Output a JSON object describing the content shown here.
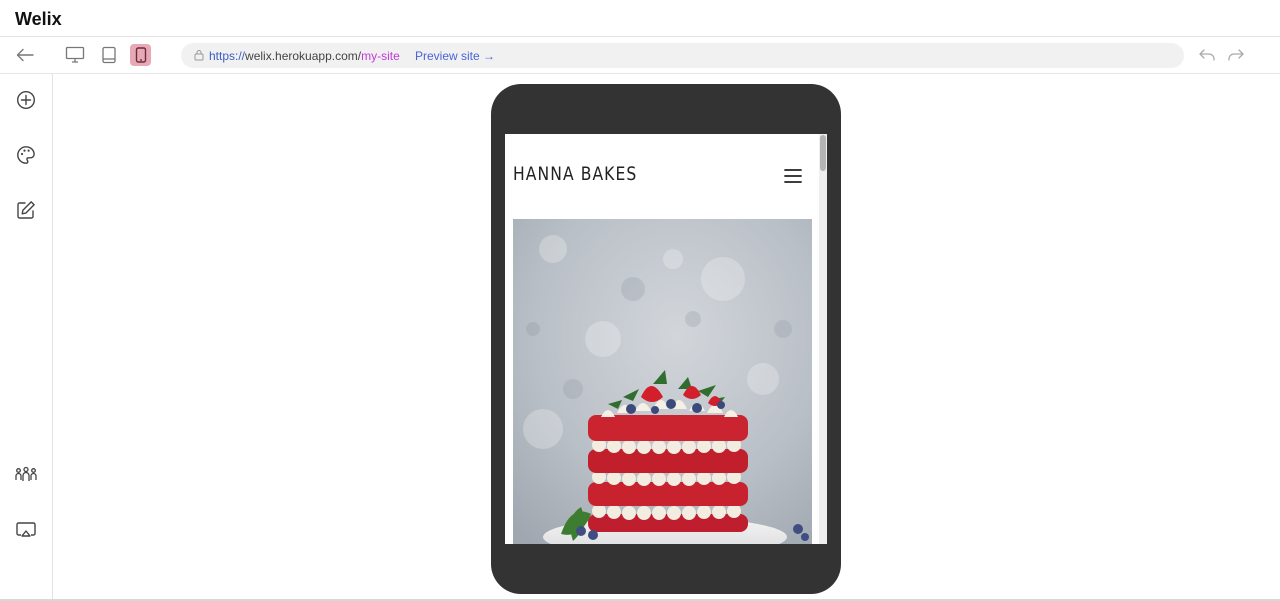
{
  "app": {
    "title": "Welix"
  },
  "toolbar": {
    "back_icon": "arrow-left-icon",
    "views": [
      {
        "name": "desktop",
        "icon": "desktop-icon",
        "active": false
      },
      {
        "name": "tablet",
        "icon": "tablet-icon",
        "active": false
      },
      {
        "name": "mobile",
        "icon": "mobile-icon",
        "active": true
      }
    ],
    "url": {
      "protocol": "https://",
      "host": "welix.herokuapp.com/",
      "path": "my-site"
    },
    "preview_label": "Preview site →",
    "undo_icon": "undo-icon",
    "redo_icon": "redo-icon"
  },
  "sidebar": {
    "items": [
      {
        "name": "add",
        "icon": "plus-circle-icon"
      },
      {
        "name": "theme",
        "icon": "palette-icon"
      },
      {
        "name": "edit",
        "icon": "edit-icon"
      },
      {
        "name": "team",
        "icon": "team-icon"
      },
      {
        "name": "present",
        "icon": "screen-share-icon"
      }
    ]
  },
  "preview": {
    "site_title": "HANNA BAKES",
    "menu_icon": "hamburger-icon",
    "hero_image": "red-velvet-layer-cake-photo"
  },
  "colors": {
    "accent": "#e8a9b6",
    "device_frame": "#333333",
    "link": "#4a63d6",
    "url_path": "#c13ad9"
  }
}
